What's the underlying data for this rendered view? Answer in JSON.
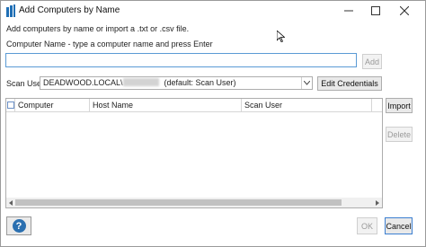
{
  "window": {
    "title": "Add Computers by Name",
    "controls": {
      "minimize": "minimize-icon",
      "maximize": "maximize-icon",
      "close": "close-icon"
    }
  },
  "intro_text": "Add computers by name or import a .txt or .csv file.",
  "computer_name": {
    "label": "Computer Name - type a computer name and press Enter",
    "value": "",
    "add_label": "Add"
  },
  "scan_user": {
    "label": "Scan User",
    "selected_prefix": "DEADWOOD.LOCAL\\",
    "selected_default": "(default: Scan User)",
    "edit_label": "Edit Credentials"
  },
  "grid": {
    "columns": [
      "Computer",
      "Host Name",
      "Scan User"
    ],
    "rows": []
  },
  "side_buttons": {
    "import_label": "Import",
    "delete_label": "Delete"
  },
  "footer": {
    "help_symbol": "?",
    "ok_label": "OK",
    "cancel_label": "Cancel"
  },
  "colors": {
    "focus_border": "#5b9bd5",
    "help_blue": "#2a6fb0",
    "app_icon": "#1f6fb5"
  }
}
